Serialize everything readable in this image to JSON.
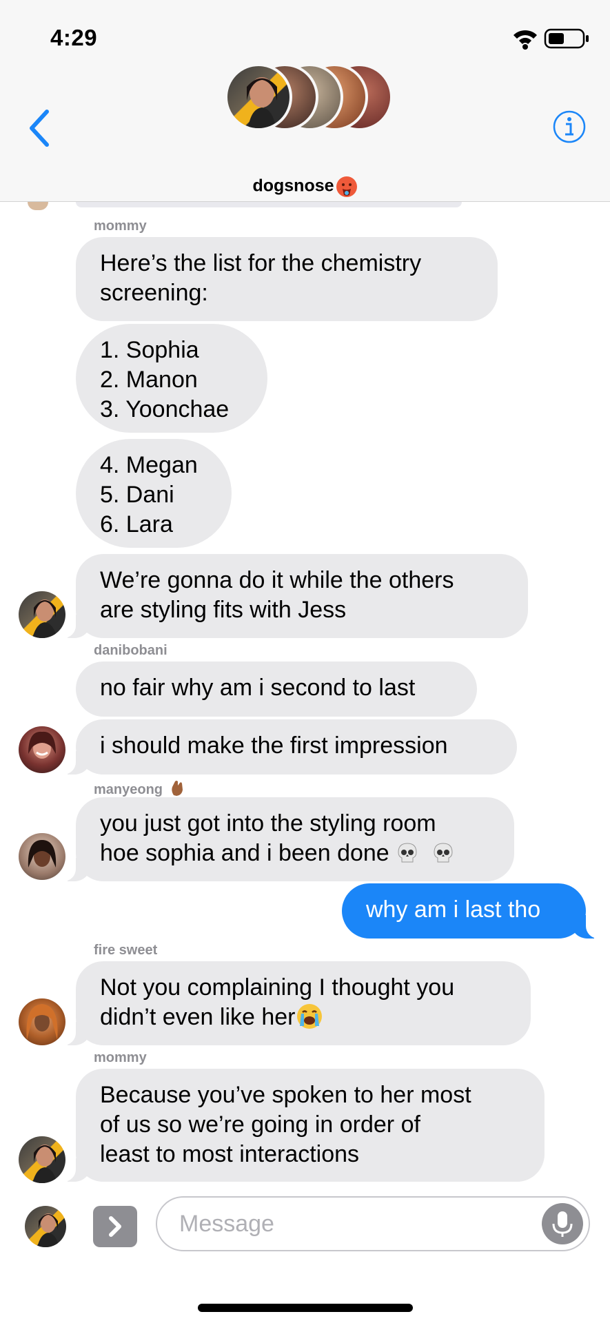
{
  "status_bar": {
    "time": "4:29"
  },
  "header": {
    "group_name": "dogsnose",
    "group_emoji": "hot-face"
  },
  "thread": {
    "items": [
      {
        "sender": "mommy"
      },
      {
        "text": [
          "Here’s the list for the chemistry",
          "screening:"
        ]
      },
      {
        "text": [
          "1. Sophia",
          "2. Manon",
          "3. Yoonchae"
        ]
      },
      {
        "text": [
          "4. Megan",
          "5. Dani",
          "6. Lara"
        ]
      },
      {
        "text": [
          "We’re gonna do it while the others",
          "are styling fits with Jess"
        ]
      },
      {
        "sender": "danibobani"
      },
      {
        "text": [
          "no fair why am i second to last"
        ]
      },
      {
        "text": [
          "i should make the first impression"
        ]
      },
      {
        "sender": "manyeong"
      },
      {
        "text": [
          "you just got into the styling room",
          "hoe sophia and i been done"
        ]
      },
      {
        "text": [
          "why am i last tho"
        ]
      },
      {
        "sender": "fire sweet"
      },
      {
        "text": [
          "Not you complaining I thought you",
          "didn’t even like her"
        ]
      },
      {
        "sender": "mommy"
      },
      {
        "text": [
          "Because you’ve spoken to her most",
          "of us so we’re going in order of",
          "least to most interactions"
        ]
      }
    ]
  },
  "input": {
    "placeholder": "Message"
  },
  "icons": {
    "back": "chevron-left-icon",
    "info": "info-icon",
    "wifi": "wifi-icon",
    "battery": "battery-icon",
    "skull": "skull-emoji",
    "crying": "crying-face-emoji",
    "hand": "hand-emoji",
    "expand": "chevron-right-icon",
    "mic": "microphone-icon"
  },
  "colors": {
    "accent": "#1b86f8",
    "incoming_bubble": "#e9e9eb",
    "sender_label": "#8e8e93"
  }
}
